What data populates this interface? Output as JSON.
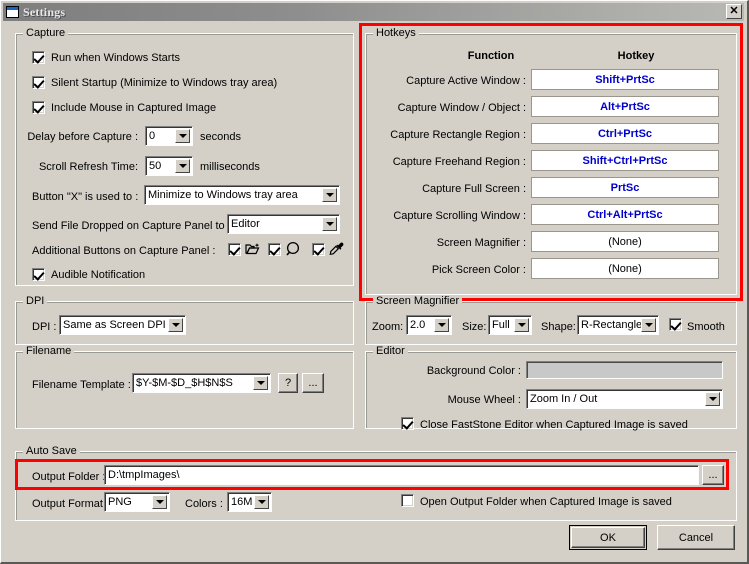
{
  "window": {
    "title": "Settings",
    "close_label": "✕",
    "icon": "window-icon"
  },
  "capture": {
    "legend": "Capture",
    "checks": [
      {
        "label": "Run when Windows Starts",
        "checked": true
      },
      {
        "label": "Silent Startup (Minimize to Windows tray area)",
        "checked": true
      },
      {
        "label": "Include Mouse in Captured Image",
        "checked": true
      }
    ],
    "delay": {
      "label": "Delay before Capture :",
      "value": "0",
      "unit": "seconds"
    },
    "scroll": {
      "label": "Scroll Refresh Time:",
      "value": "50",
      "unit": "milliseconds"
    },
    "button_x": {
      "label": "Button \"X\" is used to :",
      "value": "Minimize to Windows tray area"
    },
    "send_file": {
      "label": "Send File Dropped on Capture Panel to :",
      "value": "Editor"
    },
    "additional": {
      "label": "Additional Buttons on Capture Panel :",
      "items": [
        {
          "icon": "open-folder-icon",
          "checked": true
        },
        {
          "icon": "magnifier-icon",
          "checked": true
        },
        {
          "icon": "eyedropper-icon",
          "checked": true
        }
      ]
    },
    "audible": {
      "label": "Audible Notification",
      "checked": true
    }
  },
  "hotkeys": {
    "legend": "Hotkeys",
    "col_function": "Function",
    "col_hotkey": "Hotkey",
    "rows": [
      {
        "function": "Capture Active Window :",
        "hotkey": "Shift+PrtSc",
        "none": false
      },
      {
        "function": "Capture Window / Object :",
        "hotkey": "Alt+PrtSc",
        "none": false
      },
      {
        "function": "Capture Rectangle Region :",
        "hotkey": "Ctrl+PrtSc",
        "none": false
      },
      {
        "function": "Capture Freehand Region :",
        "hotkey": "Shift+Ctrl+PrtSc",
        "none": false
      },
      {
        "function": "Capture Full Screen :",
        "hotkey": "PrtSc",
        "none": false
      },
      {
        "function": "Capture Scrolling Window :",
        "hotkey": "Ctrl+Alt+PrtSc",
        "none": false
      },
      {
        "function": "Screen Magnifier :",
        "hotkey": "(None)",
        "none": true
      },
      {
        "function": "Pick Screen Color :",
        "hotkey": "(None)",
        "none": true
      }
    ]
  },
  "dpi": {
    "legend": "DPI",
    "label": "DPI :",
    "value": "Same as Screen DPI"
  },
  "filename": {
    "legend": "Filename",
    "label": "Filename Template :",
    "value": "$Y-$M-$D_$H$N$S",
    "help_label": "?",
    "browse_label": "..."
  },
  "magnifier": {
    "legend": "Screen Magnifier",
    "zoom_label": "Zoom:",
    "zoom_value": "2.0",
    "size_label": "Size:",
    "size_value": "Full",
    "shape_label": "Shape:",
    "shape_value": "R-Rectangle",
    "smooth_label": "Smooth",
    "smooth_checked": true
  },
  "editor": {
    "legend": "Editor",
    "bg_label": "Background Color :",
    "bg_color": "#c8c8c8",
    "wheel_label": "Mouse Wheel :",
    "wheel_value": "Zoom In / Out",
    "close_label": "Close FastStone Editor when Captured Image is saved",
    "close_checked": true
  },
  "autosave": {
    "legend": "Auto Save",
    "folder_label": "Output Folder :",
    "folder_value": "D:\\tmpImages\\",
    "browse_label": "...",
    "format_label": "Output Format :",
    "format_value": "PNG",
    "colors_label": "Colors :",
    "colors_value": "16M",
    "open_label": "Open Output Folder when Captured Image is saved",
    "open_checked": false
  },
  "footer": {
    "ok_label": "OK",
    "cancel_label": "Cancel"
  },
  "colors": {
    "face": "#d4d0c8",
    "hotkey_text": "#0000cd",
    "annotation": "#ff0000"
  }
}
